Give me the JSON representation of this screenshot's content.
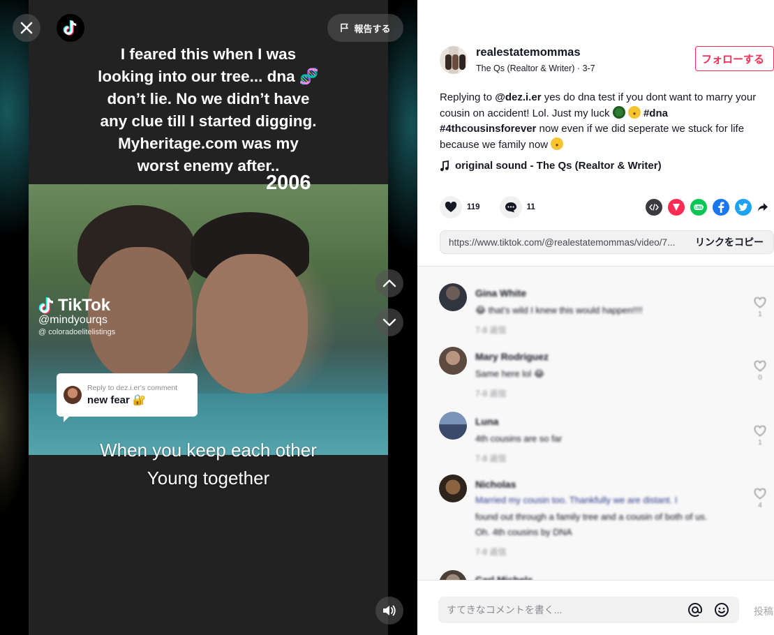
{
  "video": {
    "caption_top": "I feared this when I was\nlooking into our tree... dna 🧬\ndon’t lie. No we didn’t have\nany clue till I started digging.\nMyheritage.com was my\nworst enemy after..",
    "year": "2006",
    "caption_bottom": "When you keep each other\nYoung together",
    "watermark_brand": "TikTok",
    "watermark_handle": "@mindyourqs",
    "watermark_tag": "@ coloradoelitelistings",
    "reply_meta": "Reply to dez.i.er's comment",
    "reply_text": "new fear 🔐"
  },
  "controls": {
    "report_label": "報告する"
  },
  "author": {
    "name": "realestatemommas",
    "subtitle": "The Qs (Realtor & Writer) · 3-7",
    "follow_label": "フォローする"
  },
  "description": {
    "replying_prefix": "Replying to ",
    "mention": "@dez.i.er",
    "text_1": " yes do dna test if you dont want to marry your cousin on accident! Lol. Just my luck ",
    "tag_dna": "#dna",
    "tag_cousins": "#4thcousinsforever",
    "text_2": " now even if we did seperate we stuck for life because we family now "
  },
  "music": {
    "label": "original sound - The Qs (Realtor & Writer)"
  },
  "stats": {
    "likes": "119",
    "comments": "11"
  },
  "link": {
    "url": "https://www.tiktok.com/@realestatemommas/video/7...",
    "copy_label": "リンクをコピー"
  },
  "comments": [
    {
      "name": "Gina White",
      "line1": "😂 that’s wild I knew this would happen!!!!",
      "meta": "7-8    返信",
      "likes": "1"
    },
    {
      "name": "Mary Rodriguez",
      "line1": "Same here lol 😂",
      "meta": "7-8    返信",
      "likes": "0"
    },
    {
      "name": "Luna",
      "line1": "4th cousins are so far",
      "meta": "7-8    返信",
      "likes": "1"
    },
    {
      "name": "Nicholas",
      "line1": "Married my cousin too. Thankfully we are distant. I",
      "line2": "found out through a family tree and a cousin of both of us.",
      "line3": "Oh. 4th cousins by DNA",
      "meta": "7-8    返信",
      "likes": "4"
    },
    {
      "name": "Carl Michels",
      "line1": "",
      "meta": "",
      "likes": ""
    }
  ],
  "input": {
    "placeholder": "すてきなコメントを書く...",
    "post_label": "投稿"
  },
  "colors": {
    "accent": "#fe2c55",
    "text": "#161823",
    "muted": "#8a8b91"
  }
}
